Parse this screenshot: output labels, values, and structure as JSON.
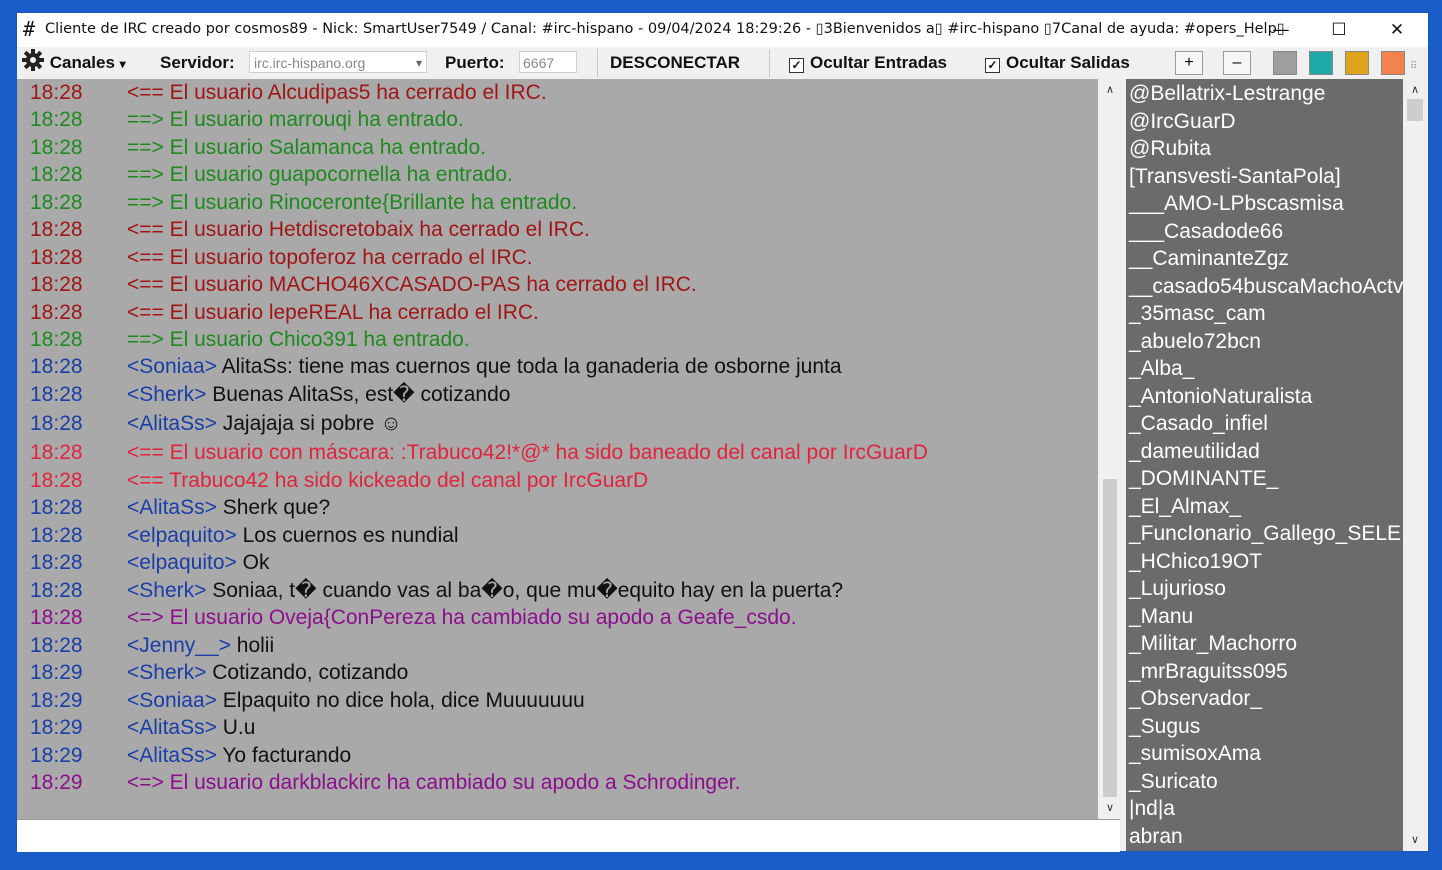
{
  "window": {
    "title": "Cliente de IRC creado por cosmos89 - Nick: SmartUser7549 / Canal: #irc-hispano - 09/04/2024 18:29:26 -   ▯3Bienvenidos a▯ #irc-hispano ▯7Canal de ayuda: #opers_Help▯",
    "app_icon": "#",
    "minimize": "—",
    "maximize": "☐",
    "close": "✕"
  },
  "toolbar": {
    "channels_label": "Canales",
    "channels_arrow": "▾",
    "server_label": "Servidor:",
    "server_value": "irc.irc-hispano.org",
    "port_label": "Puerto:",
    "port_value": "6667",
    "disconnect_label": "DESCONECTAR",
    "hide_joins_label": "Ocultar Entradas",
    "hide_parts_label": "Ocultar Salidas",
    "plus_label": "+",
    "minus_label": "–",
    "check_mark": "✓",
    "gear_icon": "gear-icon",
    "swatch_colors": [
      "#9e9e9e",
      "#1ea9a6",
      "#e0a31c",
      "#f4824f"
    ]
  },
  "chat": {
    "colors": {
      "quit": "#a01616",
      "join": "#1e8a1e",
      "msg_nick": "#1a3ea8",
      "msg_text": "#111111",
      "ban": "#e0243c",
      "nickchange": "#8c0e8c"
    },
    "lines": [
      {
        "time": "18:28",
        "type": "quit",
        "text": "<== El usuario Alcudipas5 ha cerrado el IRC."
      },
      {
        "time": "18:28",
        "type": "join",
        "text": "==> El usuario marrouqi ha entrado."
      },
      {
        "time": "18:28",
        "type": "join",
        "text": "==> El usuario Salamanca ha entrado."
      },
      {
        "time": "18:28",
        "type": "join",
        "text": "==> El usuario guapocornella ha entrado."
      },
      {
        "time": "18:28",
        "type": "join",
        "text": "==> El usuario Rinoceronte{Brillante ha entrado."
      },
      {
        "time": "18:28",
        "type": "quit",
        "text": "<== El usuario Hetdiscretobaix ha cerrado el IRC."
      },
      {
        "time": "18:28",
        "type": "quit",
        "text": "<== El usuario topoferoz ha cerrado el IRC."
      },
      {
        "time": "18:28",
        "type": "quit",
        "text": "<== El usuario MACHO46XCASADO-PAS ha cerrado el IRC."
      },
      {
        "time": "18:28",
        "type": "quit",
        "text": "<== El usuario lepeREAL ha cerrado el IRC."
      },
      {
        "time": "18:28",
        "type": "join",
        "text": "==> El usuario Chico391 ha entrado."
      },
      {
        "time": "18:28",
        "type": "msg",
        "nick": "<Soniaa>",
        "text": "AlitaSs: tiene mas cuernos que toda la ganaderia de osborne junta"
      },
      {
        "time": "18:28",
        "type": "msg",
        "nick": "<Sherk>",
        "text": "Buenas AlitaSs, est� cotizando"
      },
      {
        "time": "18:28",
        "type": "msg",
        "nick": "<AlitaSs>",
        "text": "Jajajaja si pobre ☺"
      },
      {
        "time": "18:28",
        "type": "ban",
        "text": "<== El usuario con máscara: :Trabuco42!*@* ha sido baneado del canal por IrcGuarD"
      },
      {
        "time": "18:28",
        "type": "ban",
        "text": "<== Trabuco42 ha sido kickeado del canal por IrcGuarD"
      },
      {
        "time": "18:28",
        "type": "msg",
        "nick": "<AlitaSs>",
        "text": "Sherk que?"
      },
      {
        "time": "18:28",
        "type": "msg",
        "nick": "<elpaquito>",
        "text": "Los cuernos es nundial"
      },
      {
        "time": "18:28",
        "type": "msg",
        "nick": "<elpaquito>",
        "text": "Ok"
      },
      {
        "time": "18:28",
        "type": "msg",
        "nick": "<Sherk>",
        "text": "Soniaa, t� cuando vas al ba�o, que mu�equito hay en la puerta?"
      },
      {
        "time": "18:28",
        "type": "nickchange",
        "text": "<=> El usuario Oveja{ConPereza ha cambiado su apodo a Geafe_csdo."
      },
      {
        "time": "18:28",
        "type": "msg",
        "nick": "<Jenny__>",
        "text": "holii"
      },
      {
        "time": "18:29",
        "type": "msg",
        "nick": "<Sherk>",
        "text": "Cotizando, cotizando"
      },
      {
        "time": "18:29",
        "type": "msg",
        "nick": "<Soniaa>",
        "text": "Elpaquito no dice hola, dice Muuuuuuu"
      },
      {
        "time": "18:29",
        "type": "msg",
        "nick": "<AlitaSs>",
        "text": "U.u"
      },
      {
        "time": "18:29",
        "type": "msg",
        "nick": "<AlitaSs>",
        "text": "Yo facturando"
      },
      {
        "time": "18:29",
        "type": "nickchange",
        "text": "<=> El usuario darkblackirc ha cambiado su apodo a Schrodinger."
      }
    ]
  },
  "nicklist": [
    "@Bellatrix-Lestrange",
    "@IrcGuarD",
    "@Rubita",
    "[Transvesti-SantaPola]",
    "___AMO-LPbscasmisa",
    "___Casadode66",
    "__CaminanteZgz",
    "__casado54buscaMachoActv",
    "_35masc_cam",
    "_abuelo72bcn",
    "_Alba_",
    "_AntonioNaturalista",
    "_Casado_infiel",
    "_dameutilidad",
    "_DOMINANTE_",
    "_El_Almax_",
    "_FuncIonario_Gallego_SELE",
    "_HChico19OT",
    "_Lujurioso",
    "_Manu",
    "_Militar_Machorro",
    "_mrBraguitss095",
    "_Observador_",
    "_Sugus",
    "_sumisoxAma",
    "_Suricato",
    "|nd|a",
    "abran"
  ],
  "scroll_arrows": {
    "up": "∧",
    "down": "∨"
  }
}
